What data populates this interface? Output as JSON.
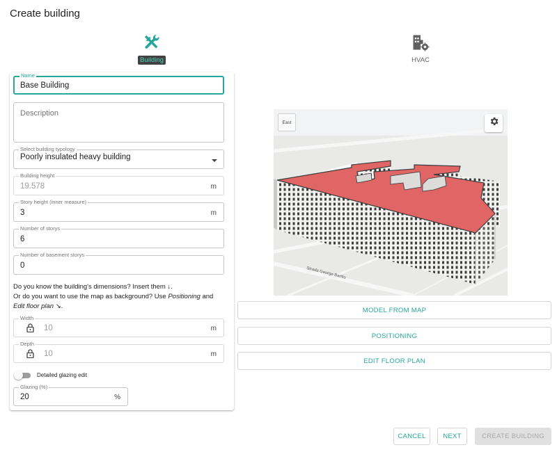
{
  "dialog": {
    "title": "Create building"
  },
  "stepper": {
    "steps": [
      {
        "label": "Building",
        "icon": "wrench-screwdriver-icon",
        "active": true
      },
      {
        "label": "HVAC",
        "icon": "building-gear-icon",
        "active": false
      }
    ]
  },
  "colors": {
    "accent": "#26a69a",
    "roof": "#e06666"
  },
  "form": {
    "name": {
      "label": "Name",
      "value": "Base Building"
    },
    "description": {
      "placeholder": "Description",
      "value": ""
    },
    "typology": {
      "label": "Select building typology",
      "value": "Poorly insulated heavy building"
    },
    "building_height": {
      "label": "Building height",
      "value": "19.578",
      "unit": "m",
      "disabled": true
    },
    "story_height": {
      "label": "Story height (inner measure)",
      "value": "3",
      "unit": "m"
    },
    "num_storys": {
      "label": "Number of storys",
      "value": "6"
    },
    "num_basement": {
      "label": "Number of basement storys",
      "value": "0"
    },
    "help": {
      "line1": "Do you know the building's dimensions? Insert them ↓.",
      "line2_pre": "Or do you want to use the map as background? Use ",
      "positioning": "Positioning",
      "and": " and",
      "edit_floor_plan": "Edit floor plan",
      "arrow": " ↘."
    },
    "width": {
      "label": "Width",
      "value": "10",
      "unit": "m",
      "locked": true
    },
    "depth": {
      "label": "Depth",
      "value": "10",
      "unit": "m",
      "locked": true
    },
    "detailed_glazing": {
      "label": "Detailed glazing edit",
      "on": false
    },
    "glazing": {
      "label": "Glazing (%)",
      "value": "20",
      "unit": "%"
    }
  },
  "map": {
    "compass_label": "East",
    "street_label": "Strada George Baritiu",
    "settings_icon": "gear-icon"
  },
  "actions": {
    "model_from_map": "MODEL FROM MAP",
    "positioning": "POSITIONING",
    "edit_floor_plan": "EDIT FLOOR PLAN"
  },
  "footer": {
    "cancel": "CANCEL",
    "next": "NEXT",
    "create": "CREATE BUILDING"
  }
}
